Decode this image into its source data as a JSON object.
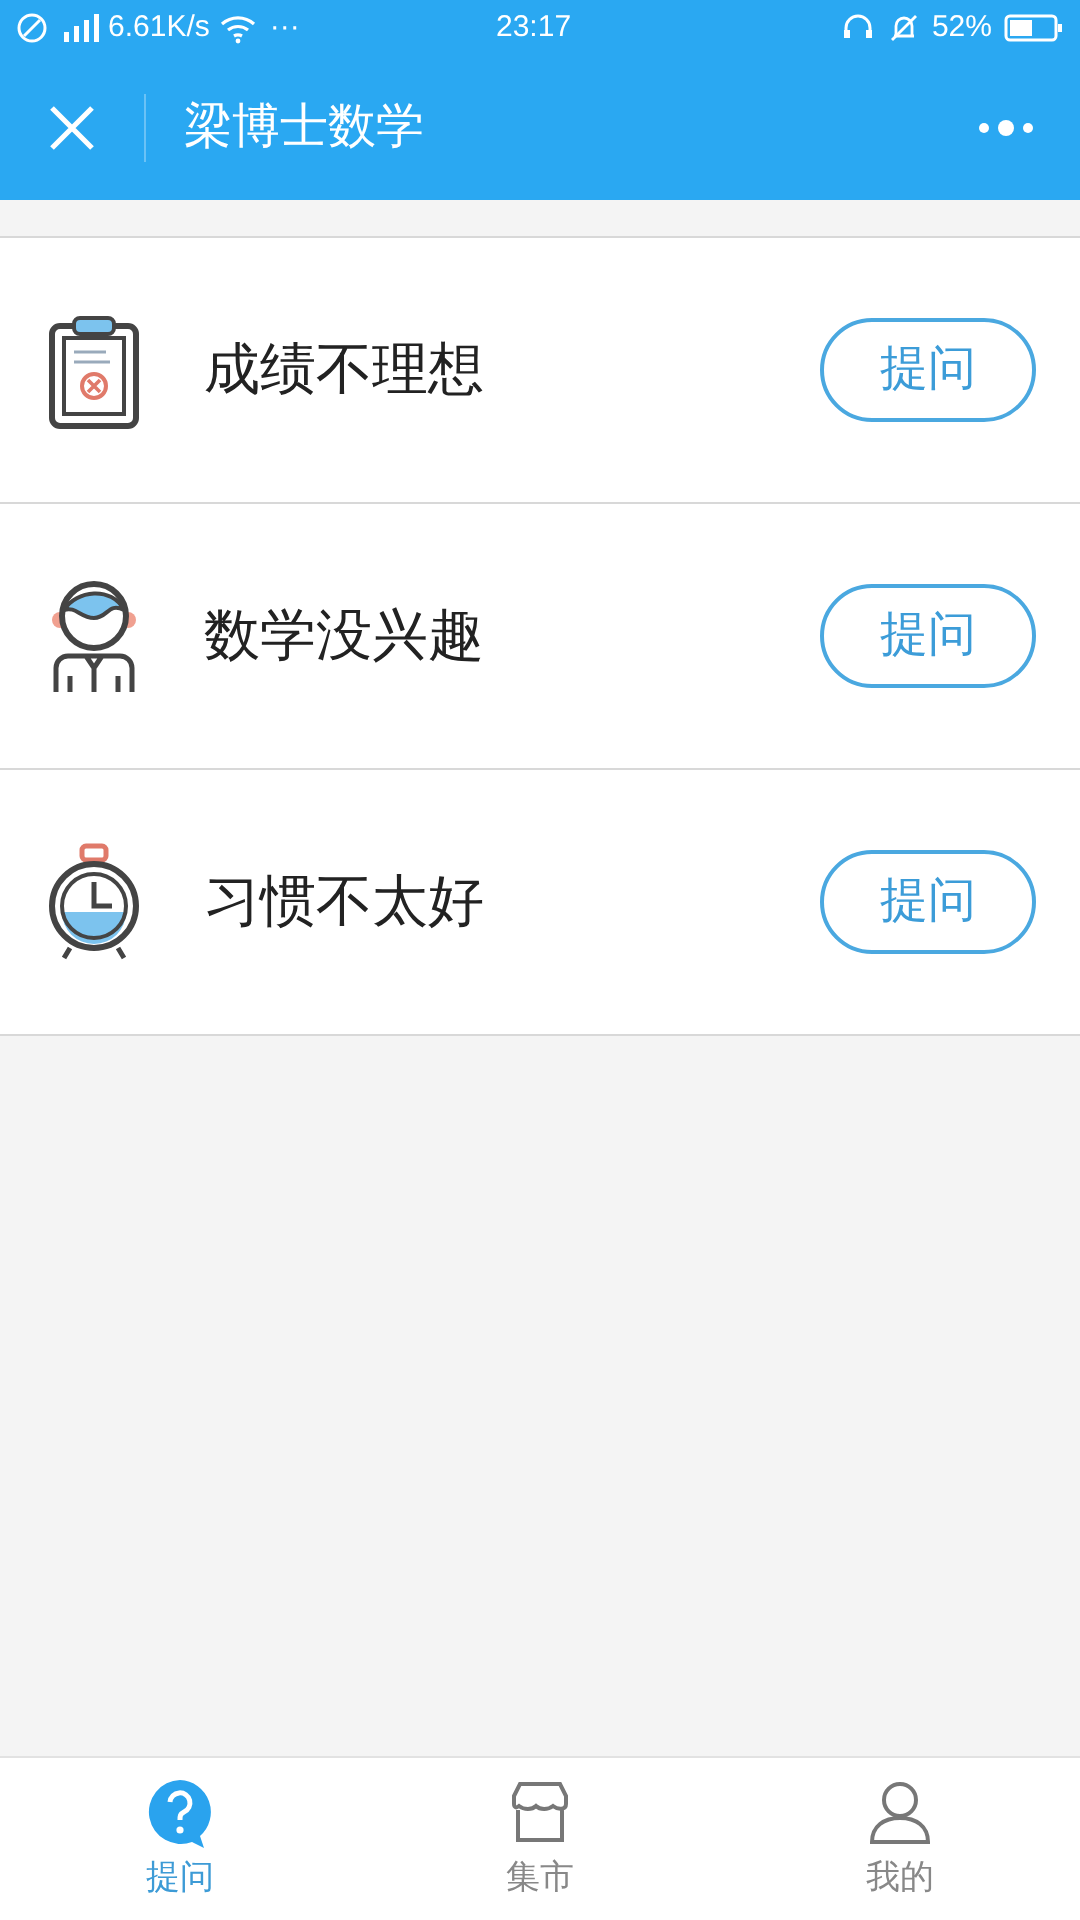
{
  "status_bar": {
    "speed": "6.61K/s",
    "more": "···",
    "time": "23:17",
    "battery": "52%"
  },
  "nav_bar": {
    "title": "梁博士数学"
  },
  "items": [
    {
      "kind": "clipboard",
      "label": "成绩不理想",
      "button": "提问"
    },
    {
      "kind": "person",
      "label": "数学没兴趣",
      "button": "提问"
    },
    {
      "kind": "clock",
      "label": "习惯不太好",
      "button": "提问"
    }
  ],
  "tab_bar": [
    {
      "kind": "question",
      "label": "提问",
      "selected": true
    },
    {
      "kind": "shop",
      "label": "集市",
      "selected": false
    },
    {
      "kind": "person",
      "label": "我的",
      "selected": false
    }
  ]
}
